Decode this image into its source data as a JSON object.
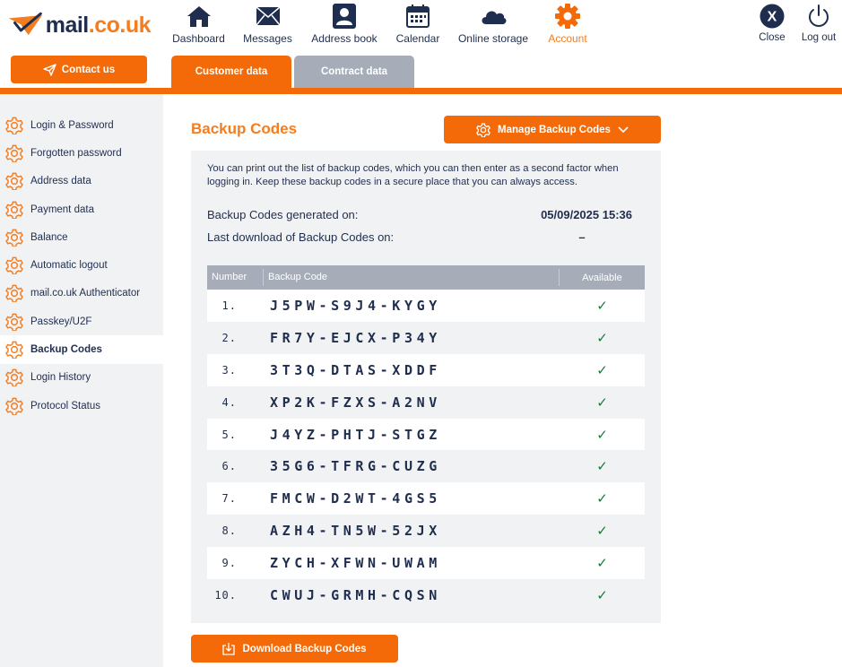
{
  "brand": {
    "name_main": "mail",
    "name_domain": ".co.uk"
  },
  "contact_button": {
    "label": "Contact us"
  },
  "nav": {
    "items": [
      {
        "label": "Dashboard",
        "icon": "house-icon"
      },
      {
        "label": "Messages",
        "icon": "envelope-icon"
      },
      {
        "label": "Address book",
        "icon": "contact-card-icon"
      },
      {
        "label": "Calendar",
        "icon": "calendar-icon"
      },
      {
        "label": "Online storage",
        "icon": "cloud-icon"
      },
      {
        "label": "Account",
        "icon": "gear-icon",
        "active": true
      }
    ],
    "close_label": "Close",
    "close_icon_text": "X",
    "logout_label": "Log out"
  },
  "tabs": [
    {
      "label": "Customer data",
      "active": true
    },
    {
      "label": "Contract data",
      "active": false
    }
  ],
  "sidebar": {
    "items": [
      {
        "label": "Login & Password"
      },
      {
        "label": "Forgotten password"
      },
      {
        "label": "Address data"
      },
      {
        "label": "Payment data"
      },
      {
        "label": "Balance"
      },
      {
        "label": "Automatic logout"
      },
      {
        "label": "mail.co.uk Authenticator"
      },
      {
        "label": "Passkey/U2F"
      },
      {
        "label": "Backup Codes",
        "active": true
      },
      {
        "label": "Login History"
      },
      {
        "label": "Protocol Status"
      }
    ]
  },
  "main": {
    "title": "Backup Codes",
    "manage_button": "Manage Backup Codes",
    "intro": "You can print out the list of backup codes, which you can then enter as a second factor when logging in. Keep these backup codes in a secure place that you can always access.",
    "generated_label": "Backup Codes generated on:",
    "generated_value": "05/09/2025 15:36",
    "download_label": "Last download of Backup Codes on:",
    "download_value": "–",
    "table": {
      "headers": [
        "Number",
        "Backup Code",
        "Available"
      ],
      "rows": [
        {
          "num": "1.",
          "code": "J5PW-S9J4-KYGY",
          "available": "✓"
        },
        {
          "num": "2.",
          "code": "FR7Y-EJCX-P34Y",
          "available": "✓"
        },
        {
          "num": "3.",
          "code": "3T3Q-DTAS-XDDF",
          "available": "✓"
        },
        {
          "num": "4.",
          "code": "XP2K-FZXS-A2NV",
          "available": "✓"
        },
        {
          "num": "5.",
          "code": "J4YZ-PHTJ-STGZ",
          "available": "✓"
        },
        {
          "num": "6.",
          "code": "35G6-TFRG-CUZG",
          "available": "✓"
        },
        {
          "num": "7.",
          "code": "FMCW-D2WT-4GS5",
          "available": "✓"
        },
        {
          "num": "8.",
          "code": "AZH4-TN5W-52JX",
          "available": "✓"
        },
        {
          "num": "9.",
          "code": "ZYCH-XFWN-UWAM",
          "available": "✓"
        },
        {
          "num": "10.",
          "code": "CWUJ-GRMH-CQSN",
          "available": "✓"
        }
      ]
    },
    "download_button": "Download Backup Codes"
  },
  "colors": {
    "accent": "#f56a08",
    "navy": "#1f2d4e",
    "grey_tab": "#a6adb9",
    "panel": "#f1f2f4",
    "check": "#1a7a3c"
  }
}
